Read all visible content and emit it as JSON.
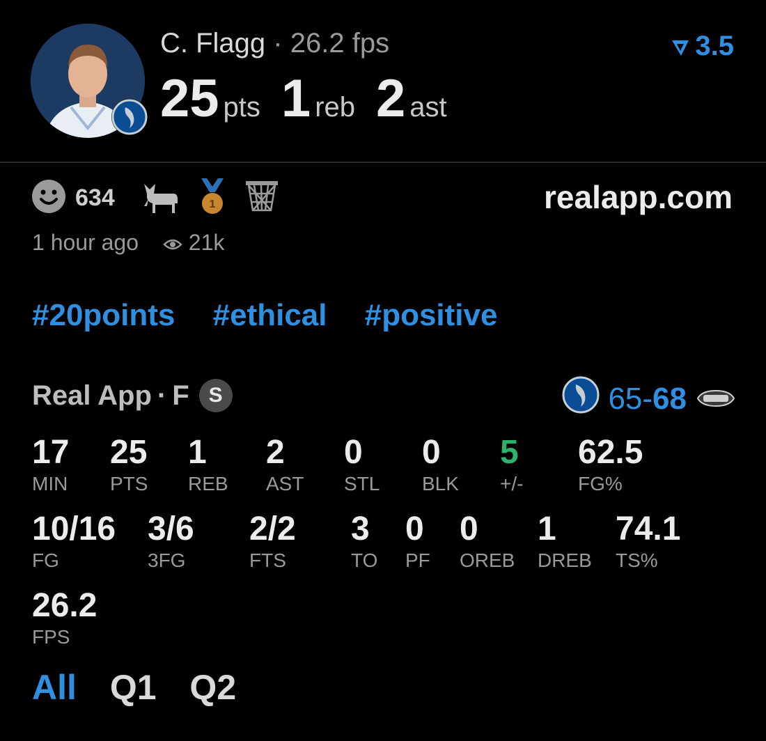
{
  "player": {
    "name": "C. Flagg",
    "separator": "·",
    "fps": "26.2 fps",
    "pts": "25",
    "pts_label": "pts",
    "reb": "1",
    "reb_label": "reb",
    "ast": "2",
    "ast_label": "ast"
  },
  "boost": {
    "value": "3.5"
  },
  "reactions": {
    "count": "634"
  },
  "site": "realapp.com",
  "meta": {
    "time": "1 hour ago",
    "views": "21k"
  },
  "tags": [
    "#20points",
    "#ethical",
    "#positive"
  ],
  "game": {
    "source": "Real App",
    "dot": "·",
    "status": "F",
    "badge": "S",
    "home_score": "65",
    "dash": "-",
    "away_score": "68"
  },
  "stats_row1": [
    {
      "v": "17",
      "l": "MIN"
    },
    {
      "v": "25",
      "l": "PTS"
    },
    {
      "v": "1",
      "l": "REB"
    },
    {
      "v": "2",
      "l": "AST"
    },
    {
      "v": "0",
      "l": "STL"
    },
    {
      "v": "0",
      "l": "BLK"
    },
    {
      "v": "5",
      "l": "+/-"
    },
    {
      "v": "62.5",
      "l": "FG%"
    }
  ],
  "stats_row2": [
    {
      "v": "10/16",
      "l": "FG"
    },
    {
      "v": "3/6",
      "l": "3FG"
    },
    {
      "v": "2/2",
      "l": "FTS"
    },
    {
      "v": "3",
      "l": "TO"
    },
    {
      "v": "0",
      "l": "PF"
    },
    {
      "v": "0",
      "l": "OREB"
    },
    {
      "v": "1",
      "l": "DREB"
    },
    {
      "v": "74.1",
      "l": "TS%"
    }
  ],
  "stats_row3": [
    {
      "v": "26.2",
      "l": "FPS"
    }
  ],
  "quarter_tabs": [
    "All",
    "Q1",
    "Q2"
  ],
  "colors": {
    "accent": "#2f8fe0",
    "positive": "#2db36a"
  }
}
